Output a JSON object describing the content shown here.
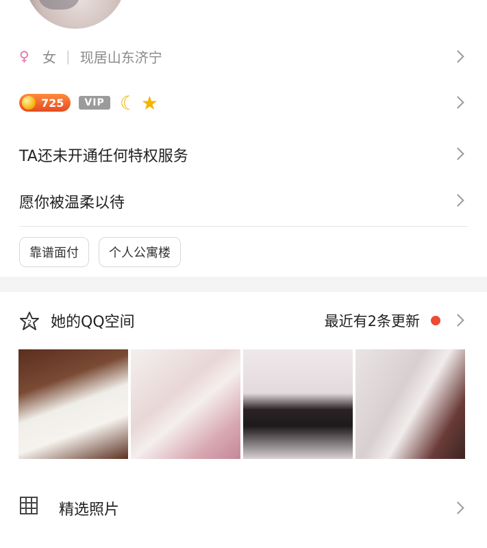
{
  "profile": {
    "gender_symbol": "♀",
    "gender": "女",
    "separator": "|",
    "location": "现居山东济宁"
  },
  "badges": {
    "level": "725",
    "vip": "VIP",
    "moon": "☾",
    "star": "★"
  },
  "privilege_text": "TA还未开通任何特权服务",
  "signature": "愿你被温柔以待",
  "tags": [
    "靠谱面付",
    "个人公寓楼"
  ],
  "qzone": {
    "icon_label": "2",
    "title": "她的QQ空间",
    "update_text": "最近有2条更新",
    "dot_color": "#ef4a36"
  },
  "photos_section": {
    "label": "精选照片"
  }
}
